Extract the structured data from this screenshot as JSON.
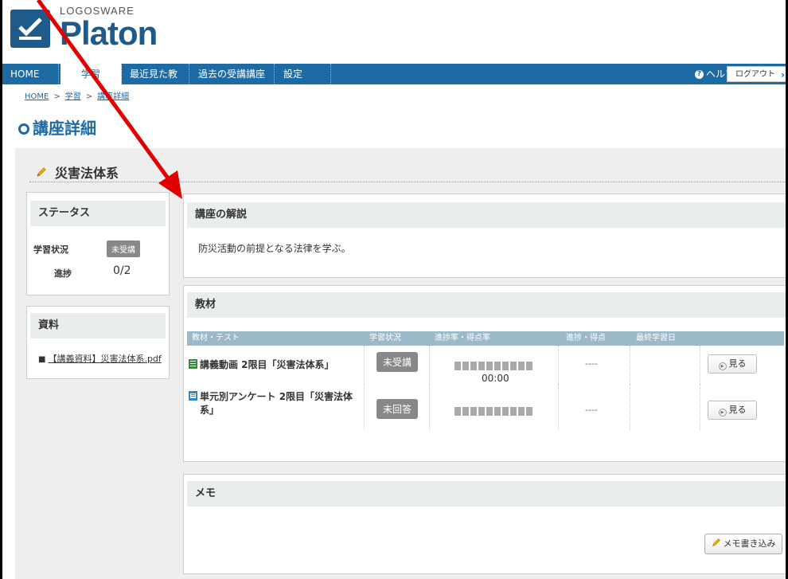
{
  "header": {
    "logo_sub": "LOGOSWARE",
    "logo_main": "Platon"
  },
  "nav": {
    "items": [
      "HOME",
      "学習",
      "最近見た教材",
      "過去の受講講座",
      "設定"
    ],
    "help": "ヘルプ",
    "logout": "ログアウト"
  },
  "breadcrumb": [
    "HOME",
    "学習",
    "講座詳細"
  ],
  "page_title": "講座詳細",
  "course_title": "災害法体系",
  "status_panel": {
    "title": "ステータス",
    "study_label": "学習状況",
    "study_value": "未受講",
    "progress_label": "進捗",
    "progress_value": "0/2"
  },
  "docs_panel": {
    "title": "資料",
    "link": "【講義資料】災害法体系.pdf"
  },
  "desc_panel": {
    "title": "講座の解説",
    "text": "防災活動の前提となる法律を学ぶ。"
  },
  "materials_panel": {
    "title": "教材",
    "columns": [
      "教材・テスト",
      "学習状況",
      "進捗率・得点率",
      "進捗・得点",
      "最終学習日"
    ],
    "rows": [
      {
        "name": "講義動画 2限目「災害法体系」",
        "status": "未受講",
        "time": "00:00",
        "progress": "----",
        "last": "",
        "button": "見る"
      },
      {
        "name_line1": "単元別アンケート 2限目「災害法体",
        "name_line2": "系」",
        "status": "未回答",
        "progress": "----",
        "last": "",
        "button": "見る"
      }
    ]
  },
  "memo_panel": {
    "title": "メモ",
    "button": "メモ書き込み"
  },
  "colors": {
    "brand_blue": "#1d6aa5",
    "badge_gray": "#888888",
    "annotation_red": "#e00000"
  }
}
